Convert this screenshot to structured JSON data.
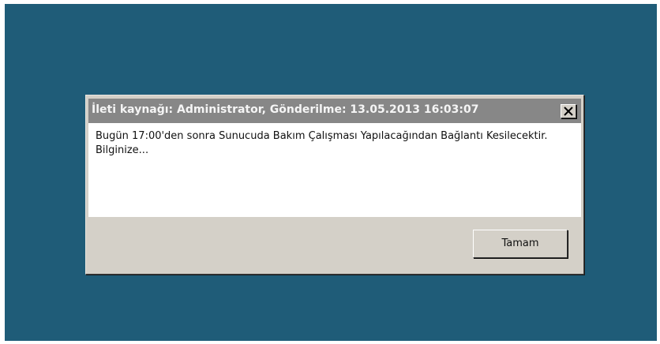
{
  "dialog": {
    "title": "İleti kaynağı: Administrator, Gönderilme: 13.05.2013 16:03:07",
    "message": "Bugün 17:00'den sonra Sunucuda Bakım Çalışması Yapılacağından Bağlantı Kesilecektir. Bilginize...",
    "ok_label": "Tamam",
    "close_icon": "close-icon"
  },
  "colors": {
    "desktop": "#1f5c78",
    "titlebar": "#878787",
    "dialog_face": "#d4d0c8",
    "content_bg": "#ffffff"
  }
}
